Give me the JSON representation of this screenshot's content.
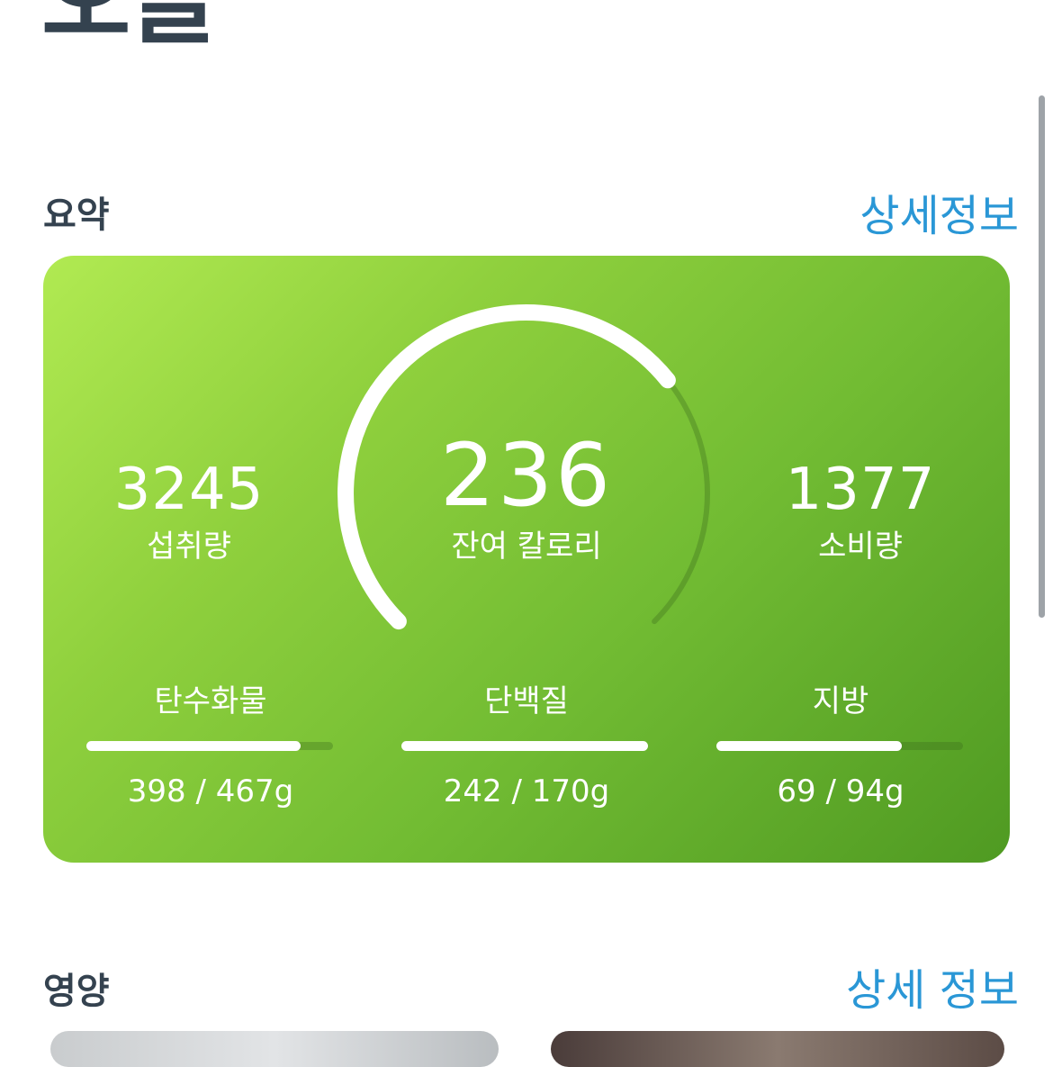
{
  "header": {
    "title": "오늘"
  },
  "summary": {
    "title": "요약",
    "link": "상세정보",
    "intake": {
      "value": "3245",
      "label": "섭취량"
    },
    "remaining": {
      "value": "236",
      "label": "잔여 칼로리"
    },
    "burned": {
      "value": "1377",
      "label": "소비량"
    },
    "gauge_fraction": 0.69,
    "macros": [
      {
        "label": "탄수화물",
        "value": "398 / 467g",
        "fraction": 0.87
      },
      {
        "label": "단백질",
        "value": "242 / 170g",
        "fraction": 1.0
      },
      {
        "label": "지방",
        "value": "69 / 94g",
        "fraction": 0.75
      }
    ]
  },
  "nutrition": {
    "title": "영양",
    "link": "상세 정보"
  },
  "colors": {
    "accent": "#2a97d6",
    "card_start": "#b1ea52",
    "card_end": "#4f9a22"
  }
}
